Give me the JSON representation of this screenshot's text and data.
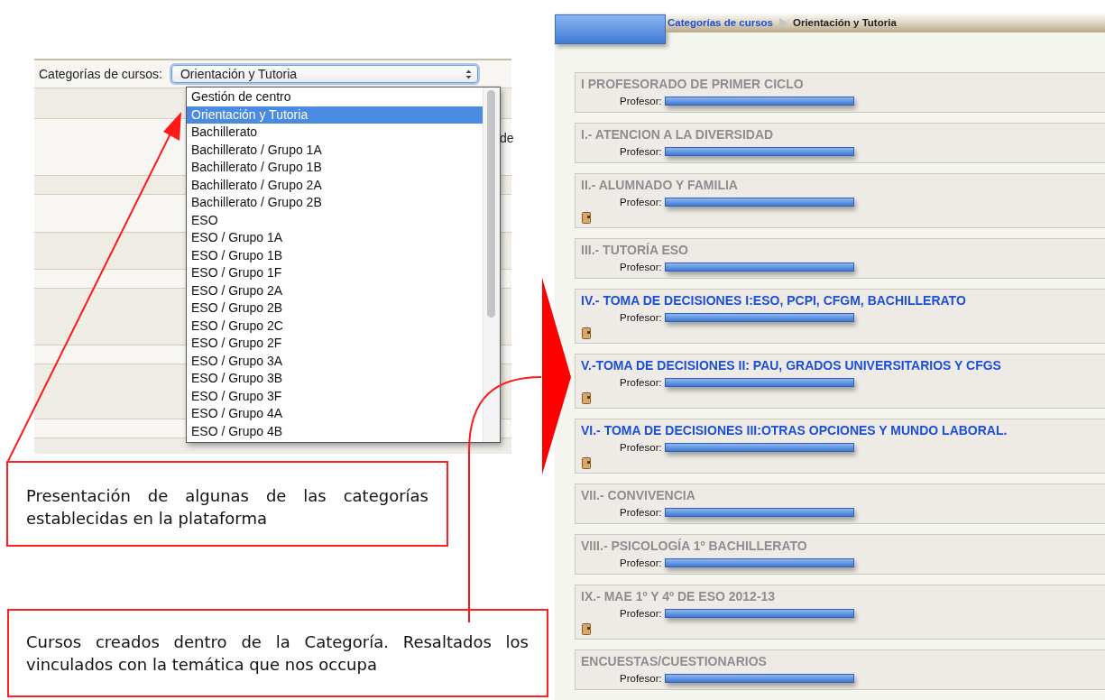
{
  "category_selector": {
    "label": "Categorías de cursos:",
    "value": "Orientación y Tutoria",
    "cut_text": "de",
    "options": [
      {
        "label": "Gestión de centro",
        "selected": false
      },
      {
        "label": "Orientación y Tutoria",
        "selected": true
      },
      {
        "label": "Bachillerato",
        "selected": false
      },
      {
        "label": "Bachillerato / Grupo 1A",
        "selected": false
      },
      {
        "label": "Bachillerato / Grupo 1B",
        "selected": false
      },
      {
        "label": "Bachillerato / Grupo 2A",
        "selected": false
      },
      {
        "label": "Bachillerato / Grupo 2B",
        "selected": false
      },
      {
        "label": "ESO",
        "selected": false
      },
      {
        "label": "ESO / Grupo 1A",
        "selected": false
      },
      {
        "label": "ESO / Grupo 1B",
        "selected": false
      },
      {
        "label": "ESO / Grupo 1F",
        "selected": false
      },
      {
        "label": "ESO / Grupo 2A",
        "selected": false
      },
      {
        "label": "ESO / Grupo 2B",
        "selected": false
      },
      {
        "label": "ESO / Grupo 2C",
        "selected": false
      },
      {
        "label": "ESO / Grupo 2F",
        "selected": false
      },
      {
        "label": "ESO / Grupo 3A",
        "selected": false
      },
      {
        "label": "ESO / Grupo 3B",
        "selected": false
      },
      {
        "label": "ESO / Grupo 3F",
        "selected": false
      },
      {
        "label": "ESO / Grupo 4A",
        "selected": false
      },
      {
        "label": "ESO / Grupo 4B",
        "selected": false
      }
    ]
  },
  "course_category_page": {
    "breadcrumb": [
      {
        "label": "Categorías de cursos",
        "kind": "link"
      },
      {
        "label": "Orientación y Tutoria",
        "kind": "current"
      }
    ],
    "courses": [
      {
        "title": "I PROFESORADO DE PRIMER CICLO",
        "teacher_label": "Profesor:",
        "highlighted": false,
        "has_icon": false
      },
      {
        "title": "I.- ATENCION A LA DIVERSIDAD",
        "teacher_label": "Profesor:",
        "highlighted": false,
        "has_icon": false
      },
      {
        "title": "II.- ALUMNADO Y FAMILIA",
        "teacher_label": "Profesor:",
        "highlighted": false,
        "has_icon": true
      },
      {
        "title": "III.- TUTORÍA ESO",
        "teacher_label": "Profesor:",
        "highlighted": false,
        "has_icon": false
      },
      {
        "title": "IV.- TOMA DE DECISIONES I:ESO, PCPI, CFGM, BACHILLERATO",
        "teacher_label": "Profesor:",
        "highlighted": true,
        "has_icon": true
      },
      {
        "title": "V.-TOMA DE DECISIONES II: PAU, GRADOS UNIVERSITARIOS Y CFGS",
        "teacher_label": "Profesor:",
        "highlighted": true,
        "has_icon": true
      },
      {
        "title": "VI.- TOMA DE DECISIONES III:OTRAS OPCIONES Y MUNDO LABORAL.",
        "teacher_label": "Profesor:",
        "highlighted": true,
        "has_icon": true
      },
      {
        "title": "VII.- CONVIVENCIA",
        "teacher_label": "Profesor:",
        "highlighted": false,
        "has_icon": false
      },
      {
        "title": "VIII.- PSICOLOGÍA 1º BACHILLERATO",
        "teacher_label": "Profesor:",
        "highlighted": false,
        "has_icon": false
      },
      {
        "title": "IX.- MAE 1º Y 4º DE ESO 2012-13",
        "teacher_label": "Profesor:",
        "highlighted": false,
        "has_icon": true
      },
      {
        "title": "ENCUESTAS/CUESTIONARIOS",
        "teacher_label": "Profesor:",
        "highlighted": false,
        "has_icon": false
      }
    ]
  },
  "callouts": [
    {
      "text": "Presentación de algunas de las categorías establecidas en la plataforma"
    },
    {
      "text": "Cursos creados dentro de la Categoría. Resaltados los vinculados con la temática que nos occupa"
    }
  ]
}
